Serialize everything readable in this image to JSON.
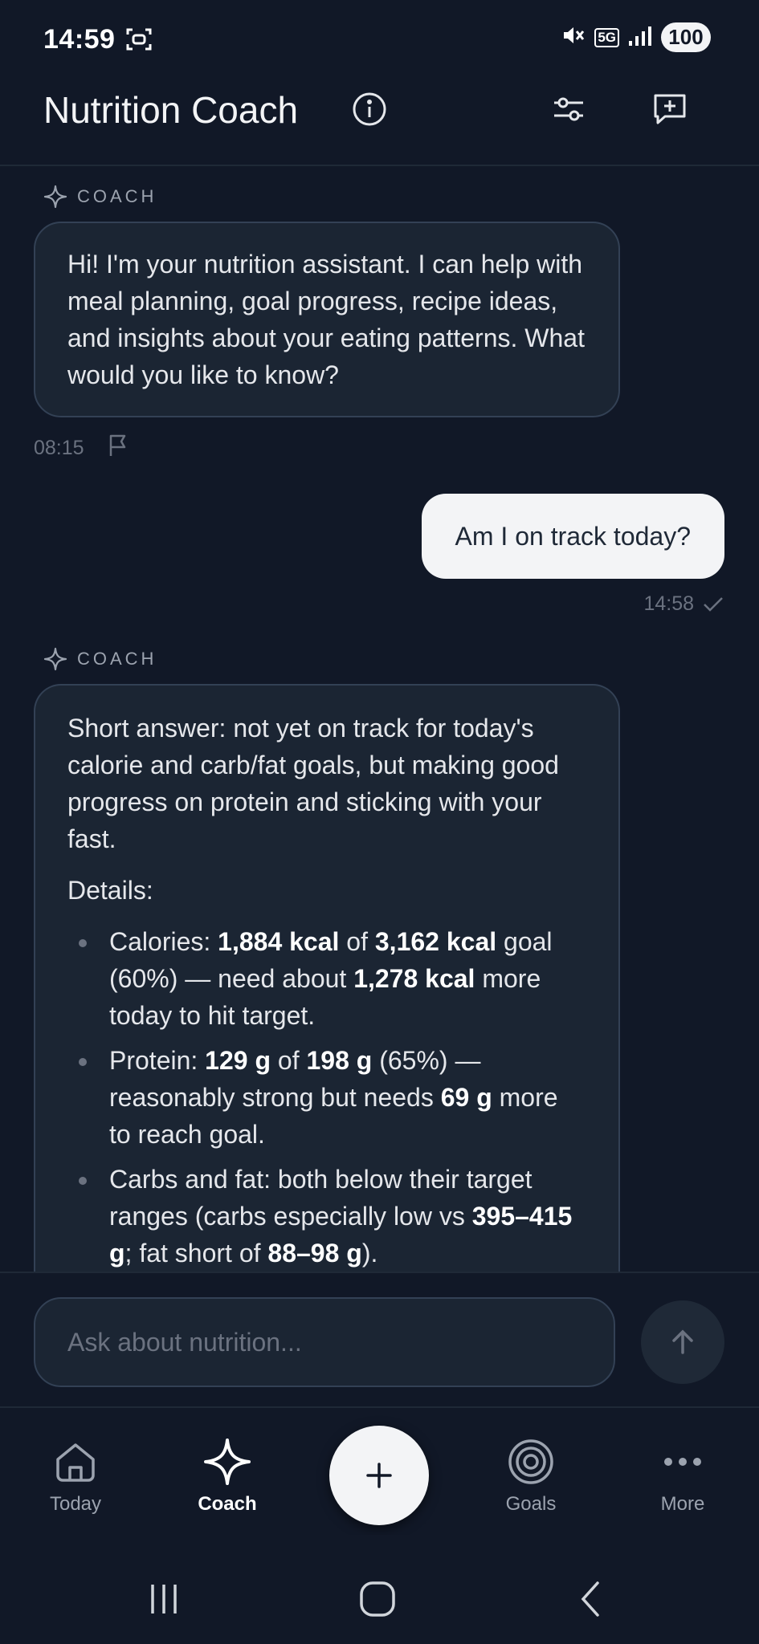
{
  "status_bar": {
    "time": "14:59",
    "network": "5G",
    "battery": "100"
  },
  "header": {
    "title": "Nutrition Coach"
  },
  "chat": {
    "sender_label": "COACH",
    "messages": [
      {
        "role": "coach",
        "text": "Hi! I'm your nutrition assistant. I can help with meal planning, goal progress, recipe ideas, and insights about your eating patterns. What would you like to know?",
        "time": "08:15"
      },
      {
        "role": "user",
        "text": "Am I on track today?",
        "time": "14:58"
      },
      {
        "role": "coach",
        "intro": "Short answer: not yet on track for today's calorie and carb/fat goals, but making good progress on protein and sticking with your fast.",
        "details_label": "Details:",
        "bullets": {
          "calories": {
            "label": "Calories: ",
            "value": "1,884 kcal",
            "mid1": " of ",
            "goal": "3,162 kcal",
            "mid2": " goal (60%) — need about ",
            "remaining": "1,278 kcal",
            "end": " more today to hit target."
          },
          "protein": {
            "label": "Protein: ",
            "value": "129 g",
            "mid1": " of ",
            "goal": "198 g",
            "mid2": " (65%) — reasonably strong but needs ",
            "remaining": "69 g",
            "end": " more to reach goal."
          },
          "carbs_fat": {
            "label": "Carbs and fat: both below their target ranges (carbs especially low vs ",
            "carb_range": "395–415 g",
            "mid": "; fat short of ",
            "fat_range": "88–98 g",
            "end": ")."
          }
        }
      }
    ]
  },
  "composer": {
    "placeholder": "Ask about nutrition..."
  },
  "bottom_nav": {
    "today": "Today",
    "coach": "Coach",
    "goals": "Goals",
    "more": "More"
  },
  "colors": {
    "background": "#111827",
    "bubble": "#1b2533",
    "user_bubble": "#f3f4f6",
    "muted": "#6b7280"
  }
}
